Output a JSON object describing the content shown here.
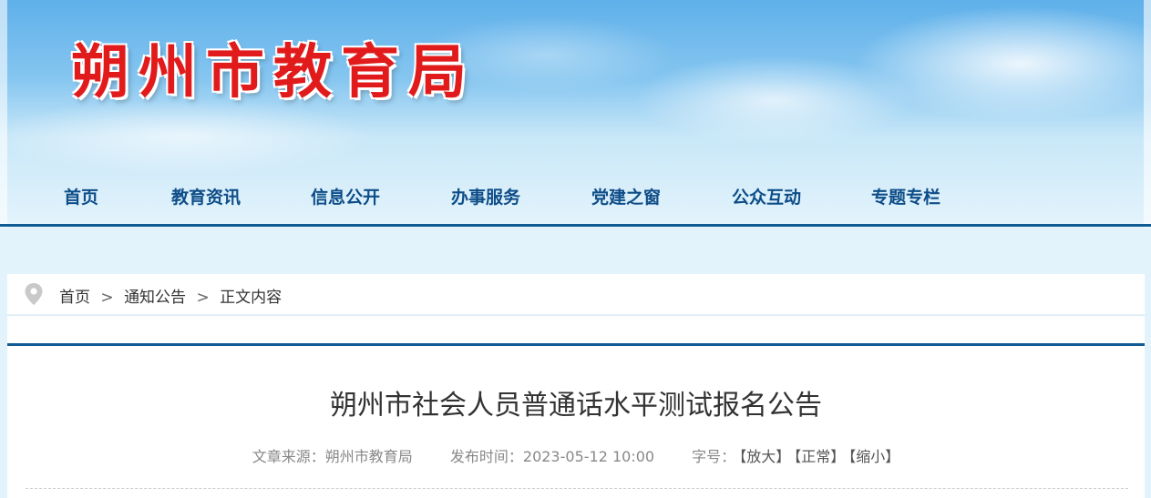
{
  "header": {
    "site_title": "朔州市教育局"
  },
  "nav": {
    "items": [
      {
        "label": "首页"
      },
      {
        "label": "教育资讯"
      },
      {
        "label": "信息公开"
      },
      {
        "label": "办事服务"
      },
      {
        "label": "党建之窗"
      },
      {
        "label": "公众互动"
      },
      {
        "label": "专题专栏"
      }
    ]
  },
  "breadcrumb": {
    "icon": "location-pin-icon",
    "items": [
      "首页",
      "通知公告",
      "正文内容"
    ],
    "separator": ">"
  },
  "article": {
    "title": "朔州市社会人员普通话水平测试报名公告",
    "source_label": "文章来源：",
    "source": "朔州市教育局",
    "date_label": "发布时间：",
    "date": "2023-05-12 10:00",
    "font_size_label": "字号：",
    "font_size_options": [
      "【放大】",
      "【正常】",
      "【缩小】"
    ]
  },
  "colors": {
    "nav_text": "#0e4d88",
    "accent_line": "#105b94",
    "logo_red": "#e11b1b"
  }
}
